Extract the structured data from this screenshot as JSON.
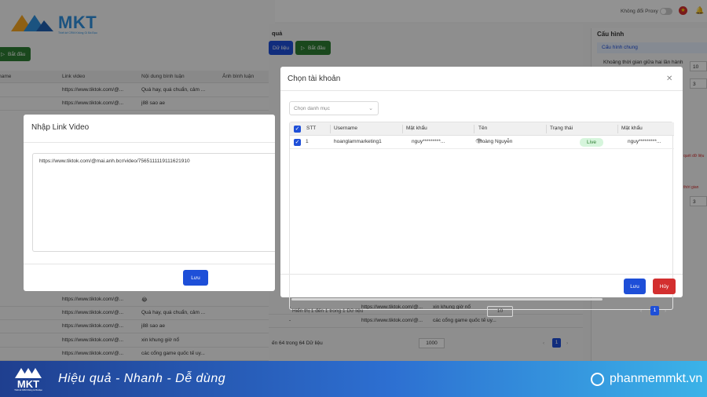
{
  "brand": {
    "name": "MKT",
    "tagline": "Thiết kế CRM Không Gì Bá Đạo",
    "colors": {
      "primary": "#1e4fd8",
      "success": "#2e7d32",
      "danger": "#d32f2f",
      "live_bg": "#d6f5dc"
    }
  },
  "topbar": {
    "proxy_label": "Không đổi Proxy"
  },
  "bg_left": {
    "start_button": "Bắt đầu",
    "columns": [
      "rname",
      "Link video",
      "Nội dung bình luận",
      "Ảnh bình luận"
    ],
    "rows_top": [
      {
        "link": "https://www.tiktok.com/@...",
        "comment": "Quá hay, quá chuẩn, cảm ..."
      },
      {
        "link": "https://www.tiktok.com/@...",
        "comment": "j88 sao ae"
      }
    ],
    "rows_bottom": [
      {
        "link": "https://www.tiktok.com/@...",
        "comment": "😂"
      },
      {
        "link": "https://www.tiktok.com/@...",
        "comment": "Quá hay, quá chuẩn, cảm ..."
      },
      {
        "link": "https://www.tiktok.com/@...",
        "comment": "j88 sao ae"
      },
      {
        "link": "https://www.tiktok.com/@...",
        "comment": "xin khung giờ nổ"
      },
      {
        "link": "https://www.tiktok.com/@...",
        "comment": "các cổng game quốc tế uy..."
      }
    ]
  },
  "bg_mid": {
    "heading": "quả",
    "data_button": "Dữ liệu",
    "start_button": "Bắt đầu",
    "rows": [
      {
        "col1": "-",
        "link": "https://www.tiktok.com/@...",
        "comment": "xin khung giờ nổ"
      },
      {
        "col1": "-",
        "link": "https://www.tiktok.com/@...",
        "comment": "các cổng game quốc tế uy..."
      }
    ],
    "footer_info": "ến 64 trong 64 Dữ liệu",
    "page_size": "1000",
    "current_page": "1"
  },
  "bg_right": {
    "heading": "Cấu hình",
    "tab": "Cấu hình chung",
    "field_label": "Khoảng thời gian giữa hai lần hành",
    "value_1": "10",
    "value_2": "3",
    "value_3": "3",
    "red_text_1": "quét dữ liệu",
    "red_text_2": "thời gian"
  },
  "modal_link": {
    "title": "Nhập Link Video",
    "textarea_value": "https://www.tiktok.com/@mai.anh.bcr/video/7565111119111621910",
    "save_label": "Lưu"
  },
  "modal_account": {
    "title": "Chọn tài khoản",
    "category_placeholder": "Chọn danh mục",
    "columns": {
      "stt": "STT",
      "username": "Username",
      "password": "Mật khẩu",
      "name": "Tên",
      "status": "Trạng thái",
      "password2": "Mật khẩu"
    },
    "rows": [
      {
        "stt": "1",
        "username": "hoanglammarketing1",
        "password": "nguy*********...",
        "name": "Hoàng Nguyễn",
        "status": "Live",
        "password2": "nguy*********..."
      }
    ],
    "footer_info": "Hiển thị 1 đến 1 trong 1 Dữ liệu",
    "page_size": "10",
    "current_page": "1",
    "save_label": "Lưu",
    "cancel_label": "Hủy"
  },
  "banner": {
    "logo": "MKT",
    "logo_sub": "Thiết kế CRM Không Gì Bá Đạo",
    "slogan": "Hiệu quả - Nhanh  - Dễ dùng",
    "site": "phanmemmkt.vn"
  }
}
